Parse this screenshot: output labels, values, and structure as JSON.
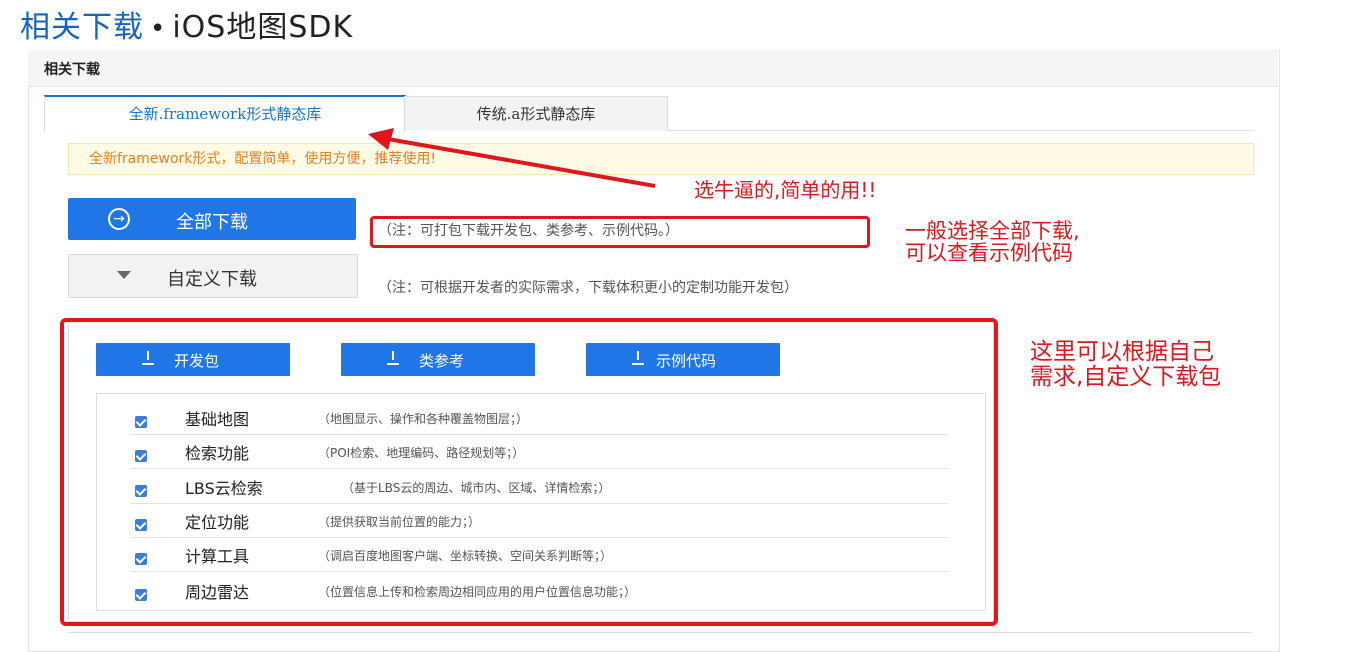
{
  "header": {
    "title_main": "相关下载",
    "title_rest": "iOS地图SDK"
  },
  "panel": {
    "heading": "相关下载"
  },
  "tabs": [
    {
      "label": "全新.framework形式静态库",
      "active": true
    },
    {
      "label": "传统.a形式静态库",
      "active": false
    }
  ],
  "notice": "全新framework形式，配置简单，使用方便，推荐使用!",
  "annotations": {
    "tab_hint": "选牛逼的,简单的用!!",
    "download_all_hint_line1": "一般选择全部下载,",
    "download_all_hint_line2": "可以查看示例代码",
    "custom_hint_line1": "这里可以根据自己",
    "custom_hint_line2": "需求,自定义下载包"
  },
  "buttons": {
    "download_all": "全部下载",
    "custom_download": "自定义下载"
  },
  "notes": {
    "download_all": "（注：可打包下载开发包、类参考、示例代码。）",
    "custom_download": "（注：可根据开发者的实际需求，下载体积更小的定制功能开发包）"
  },
  "package_buttons": {
    "dev": "开发包",
    "ref": "类参考",
    "code": "示例代码"
  },
  "modules": [
    {
      "name": "基础地图",
      "desc": "（地图显示、操作和各种覆盖物图层；）",
      "checked": true
    },
    {
      "name": "检索功能",
      "desc": "（POI检索、地理编码、路径规划等；）",
      "checked": true
    },
    {
      "name": "LBS云检索",
      "desc": "（基于LBS云的周边、城市内、区域、详情检索；）",
      "checked": true
    },
    {
      "name": "定位功能",
      "desc": "（提供获取当前位置的能力；）",
      "checked": true
    },
    {
      "name": "计算工具",
      "desc": "（调启百度地图客户端、坐标转换、空间关系判断等；）",
      "checked": true
    },
    {
      "name": "周边雷达",
      "desc": "（位置信息上传和检索周边相同应用的用户位置信息功能；）",
      "checked": true
    }
  ],
  "colors": {
    "primary": "#2076e6",
    "annotation_red": "#e0161c",
    "notice_text": "#e67e22",
    "notice_bg": "#fffbe5"
  }
}
